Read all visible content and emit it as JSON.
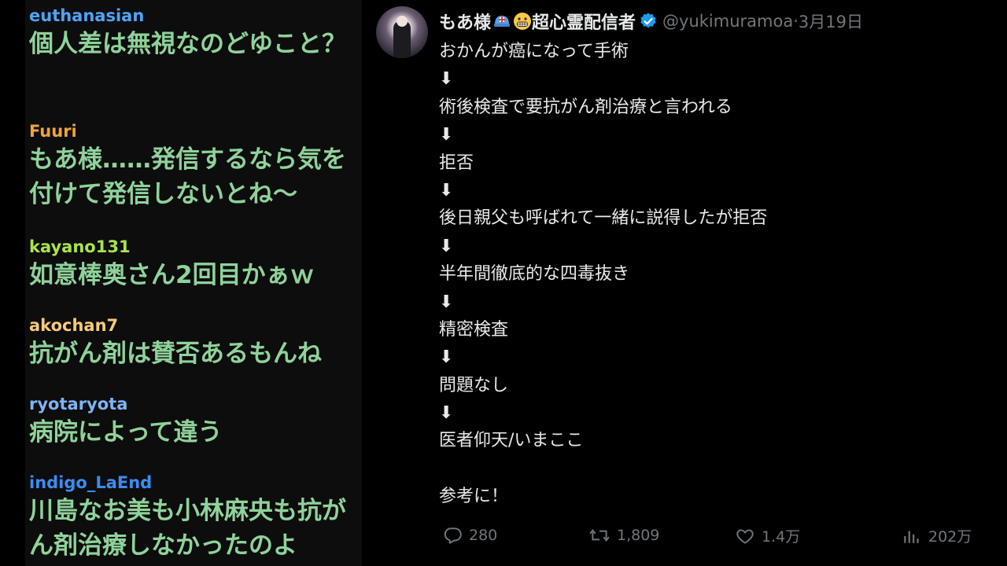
{
  "comments": [
    {
      "user": "euthanasian",
      "user_color": "#4fa3f7",
      "text": "個人差は無視なのどゆこと？"
    },
    {
      "user": "Fuuri",
      "user_color": "#f0a33c",
      "text": "もあ様……発信するなら気を付けて発信しないとね～"
    },
    {
      "user": "kayano131",
      "user_color": "#a9e34b",
      "text": "如意棒奥さん2回目かぁｗ"
    },
    {
      "user": "akochan7",
      "user_color": "#f7c97a",
      "text": "抗がん剤は賛否あるもんね"
    },
    {
      "user": "ryotaryota",
      "user_color": "#7fb3f5",
      "text": "病院によって違う"
    },
    {
      "user": "indigo_LaEnd",
      "user_color": "#3b8df0",
      "text": "川島なお美も小林麻央も抗がん剤治療しなかったのよ"
    }
  ],
  "tweet": {
    "display_name": "もあ様",
    "display_name_suffix": "超心霊配信者",
    "emoji_1": "rescue-helmet-emoji",
    "emoji_2": "grimacing-face-emoji",
    "handle": "@yukimuramoa",
    "separator": " · ",
    "date": "3月19日",
    "lines": [
      "おかんが癌になって手術",
      "⬇",
      "術後検査で要抗がん剤治療と言われる",
      "⬇",
      "拒否",
      "⬇",
      "後日親父も呼ばれて一緒に説得したが拒否",
      "⬇",
      "半年間徹底的な四毒抜き",
      "⬇",
      "精密検査",
      "⬇",
      "問題なし",
      "⬇",
      "医者仰天/いまここ",
      "",
      "参考に！"
    ],
    "actions": {
      "replies": "280",
      "retweets": "1,809",
      "likes": "1.4万",
      "views": "202万"
    },
    "colors": {
      "text": "#e7e9ea",
      "muted": "#71767b",
      "verified": "#1d9bf0"
    }
  }
}
